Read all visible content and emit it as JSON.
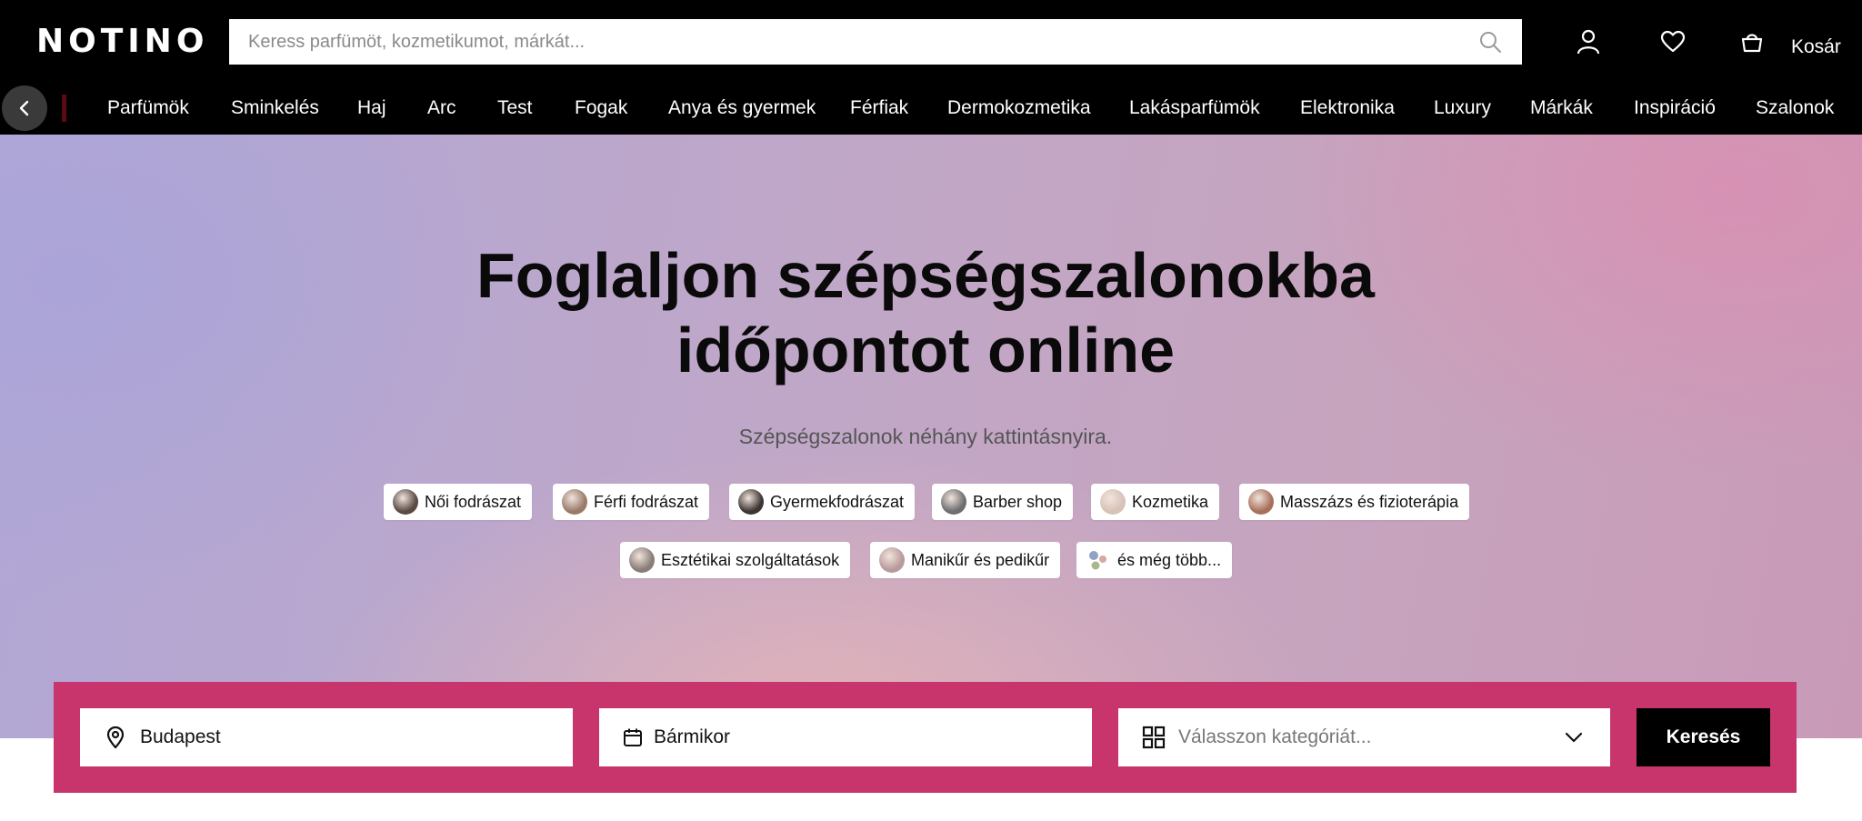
{
  "header": {
    "logo": "NOTINO",
    "search_placeholder": "Keress parfümöt, kozmetikumot, márkát...",
    "cart_label": "Kosár"
  },
  "nav": {
    "items": [
      "Parfümök",
      "Sminkelés",
      "Haj",
      "Arc",
      "Test",
      "Fogak",
      "Anya és gyermek",
      "Férfiak",
      "Dermokozmetika",
      "Lakásparfümök",
      "Elektronika",
      "Luxury",
      "Márkák",
      "Inspiráció",
      "Szalonok"
    ]
  },
  "hero": {
    "title_line1": "Foglaljon szépségszalonokba",
    "title_line2": "időpontot online",
    "subtitle": "Szépségszalonok néhány kattintásnyira."
  },
  "categories": [
    {
      "label": "Női fodrászat",
      "color": "#5a4a44"
    },
    {
      "label": "Férfi fodrászat",
      "color": "#9a7a6a"
    },
    {
      "label": "Gyermekfodrászat",
      "color": "#3d3532"
    },
    {
      "label": "Barber shop",
      "color": "#6e6e70"
    },
    {
      "label": "Kozmetika",
      "color": "#d8c2b8"
    },
    {
      "label": "Masszázs és fizioterápia",
      "color": "#a8705a"
    },
    {
      "label": "Esztétikai szolgáltatások",
      "color": "#8a7d78"
    },
    {
      "label": "Manikűr és pedikűr",
      "color": "#b89a9c"
    },
    {
      "label": "és még több...",
      "color": "#8fa3c2"
    }
  ],
  "booking": {
    "location_value": "Budapest",
    "date_value": "Bármikor",
    "category_placeholder": "Válasszon kategóriát...",
    "search_label": "Keresés",
    "accent_color": "#c8356d"
  }
}
